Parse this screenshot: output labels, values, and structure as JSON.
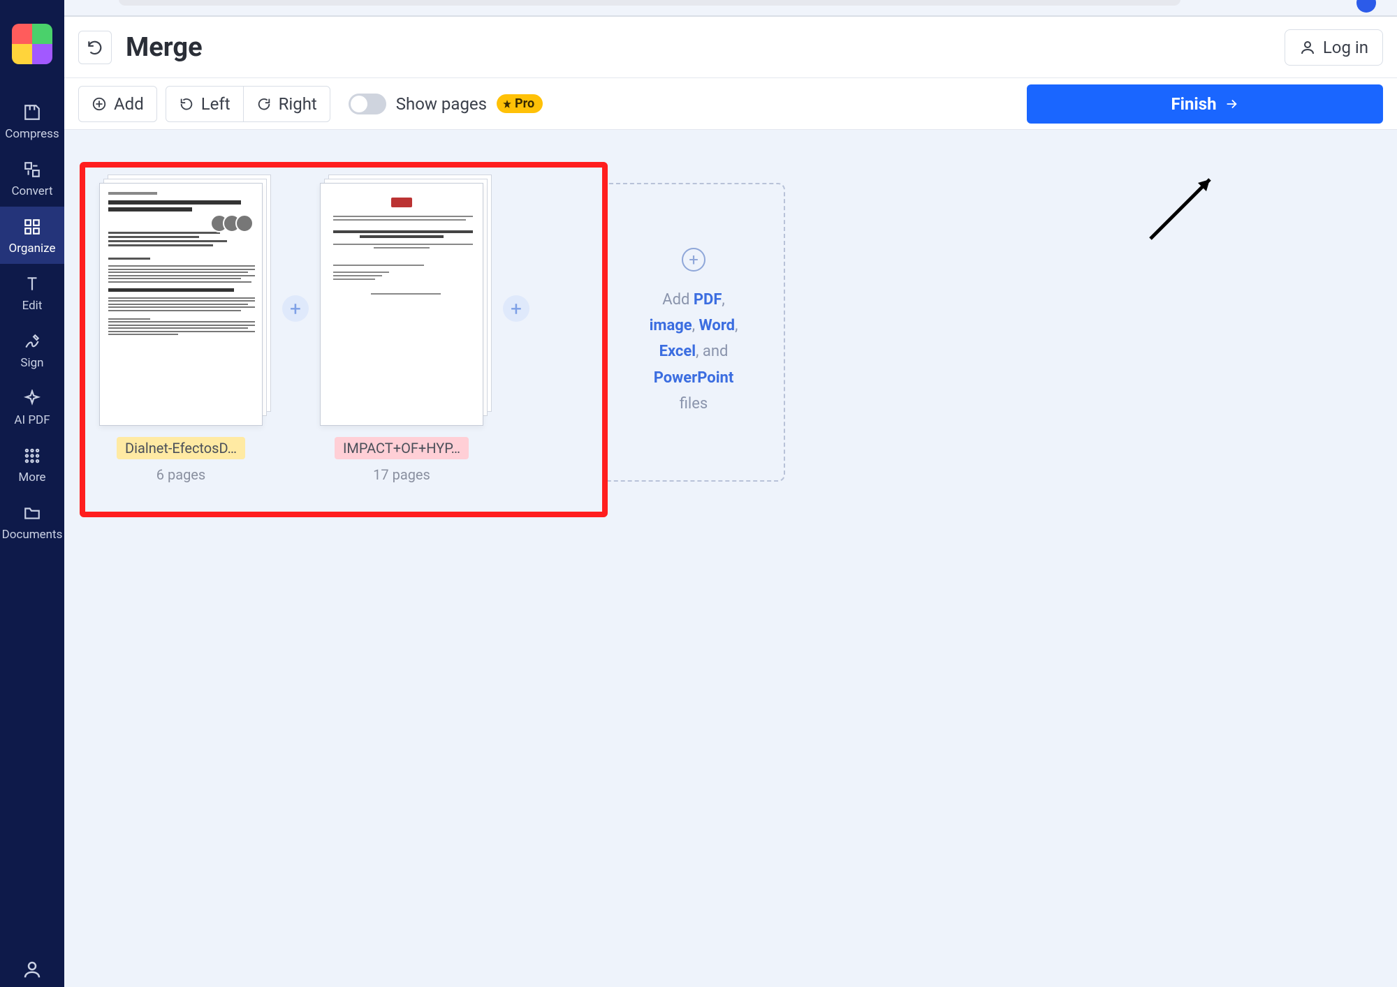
{
  "header": {
    "title": "Merge",
    "login": "Log in"
  },
  "toolbar": {
    "add": "Add",
    "left": "Left",
    "right": "Right",
    "show_pages": "Show pages",
    "pro": "Pro",
    "finish": "Finish"
  },
  "sidebar": {
    "compress": "Compress",
    "convert": "Convert",
    "organize": "Organize",
    "edit": "Edit",
    "sign": "Sign",
    "ai_pdf": "AI PDF",
    "more": "More",
    "documents": "Documents"
  },
  "files": [
    {
      "name": "Dialnet-EfectosD…",
      "pages": "6 pages",
      "badge": "yellow"
    },
    {
      "name": "IMPACT+OF+HYP…",
      "pages": "17 pages",
      "badge": "pink"
    }
  ],
  "dropzone": {
    "add_word": "Add",
    "pdf": "PDF",
    "image": "image",
    "word": "Word",
    "excel": "Excel",
    "and": ", and",
    "ppt": "PowerPoint",
    "files": "files"
  }
}
